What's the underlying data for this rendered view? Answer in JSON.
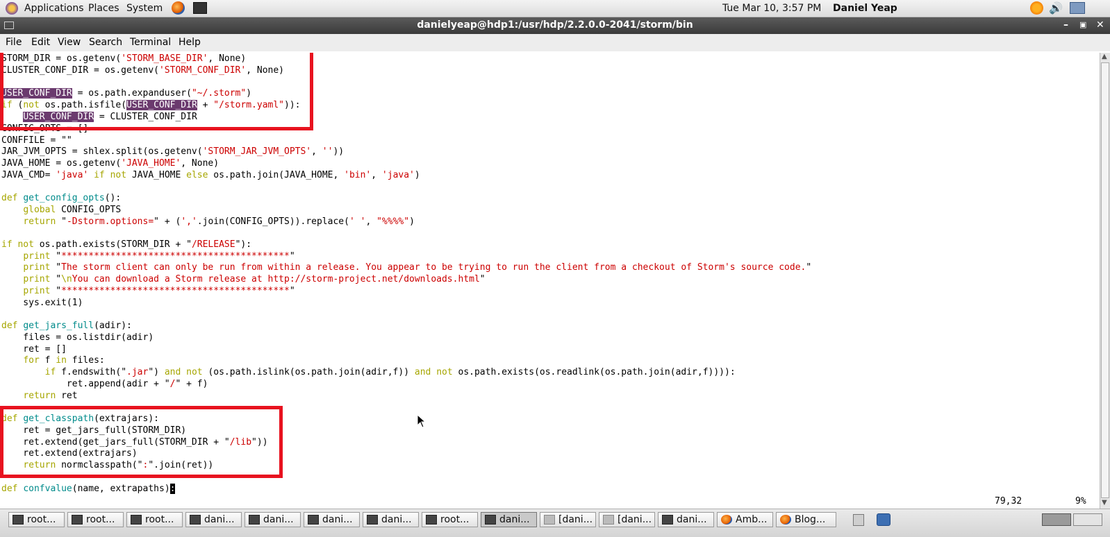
{
  "topbar": {
    "menus": [
      "Applications",
      "Places",
      "System"
    ],
    "clock": "Tue Mar 10,  3:57 PM",
    "user": "Daniel Yeap"
  },
  "window": {
    "title": "danielyeap@hdp1:/usr/hdp/2.2.0.0-2041/storm/bin",
    "menu": [
      "File",
      "Edit",
      "View",
      "Search",
      "Terminal",
      "Help"
    ]
  },
  "code": {
    "l1": [
      "STORM_DIR = os.getenv(",
      "'STORM_BASE_DIR'",
      ", None)"
    ],
    "l2": [
      "CLUSTER_CONF_DIR = os.getenv(",
      "'STORM_CONF_DIR'",
      ", None)"
    ],
    "l4": [
      "USER_CONF_DIR",
      " = os.path.expanduser(",
      "\"~/.storm\"",
      ")"
    ],
    "l5": [
      "if",
      " (",
      "not",
      " os.path.isfile(",
      "USER_CONF_DIR",
      " + ",
      "\"/storm.yaml\"",
      ")):"
    ],
    "l6": [
      "    ",
      "USER_CONF_DIR",
      " = CLUSTER_CONF_DIR"
    ],
    "l7": [
      "CONFIG_OPTS = []"
    ],
    "l8": [
      "CONFFILE = \"\""
    ],
    "l9": [
      "JAR_JVM_OPTS = shlex.split(os.getenv(",
      "'STORM_JAR_JVM_OPTS'",
      ", ",
      "''",
      "))"
    ],
    "l10": [
      "JAVA_HOME = os.getenv(",
      "'JAVA_HOME'",
      ", None)"
    ],
    "l11": [
      "JAVA_CMD= ",
      "'java'",
      " ",
      "if",
      " ",
      "not",
      " JAVA_HOME ",
      "else",
      " os.path.join(JAVA_HOME, ",
      "'bin'",
      ", ",
      "'java'",
      ")"
    ],
    "l13": [
      "def",
      " ",
      "get_config_opts",
      "():"
    ],
    "l14": [
      "    ",
      "global",
      " CONFIG_OPTS"
    ],
    "l15": [
      "    ",
      "return",
      " \"",
      "-Dstorm.options=",
      "\" + (",
      "','",
      ".join(CONFIG_OPTS)).replace(",
      "' '",
      ", ",
      "\"%%%%\"",
      ")"
    ],
    "l17": [
      "if",
      " ",
      "not",
      " os.path.exists(STORM_DIR + \"",
      "/RELEASE",
      "\"):"
    ],
    "l18": [
      "    ",
      "print",
      " \"",
      "******************************************",
      "\""
    ],
    "l19": [
      "    ",
      "print",
      " \"",
      "The storm client can only be run from within a release. You appear to be trying to run the client from a checkout of Storm's source code.",
      "\""
    ],
    "l20": [
      "    ",
      "print",
      " \"",
      "\\n",
      "You can download a Storm release at http://storm-project.net/downloads.html",
      "\""
    ],
    "l21": [
      "    ",
      "print",
      " \"",
      "******************************************",
      "\""
    ],
    "l22": [
      "    sys.exit(1)"
    ],
    "l24": [
      "def",
      " ",
      "get_jars_full",
      "(adir):"
    ],
    "l25": [
      "    files = os.listdir(adir)"
    ],
    "l26": [
      "    ret = []"
    ],
    "l27": [
      "    ",
      "for",
      " f ",
      "in",
      " files:"
    ],
    "l28": [
      "        ",
      "if",
      " f.endswith(\"",
      ".jar",
      "\") ",
      "and",
      " ",
      "not",
      " (os.path.islink(os.path.join(adir,f)) ",
      "and",
      " ",
      "not",
      " os.path.exists(os.readlink(os.path.join(adir,f)))):"
    ],
    "l29": [
      "            ret.append(adir + \"",
      "/",
      "\" + f)"
    ],
    "l30": [
      "    ",
      "return",
      " ret"
    ],
    "l32": [
      "def",
      " ",
      "get_classpath",
      "(extrajars):"
    ],
    "l33": [
      "    ret = get_jars_full(STORM_DIR)"
    ],
    "l34": [
      "    ret.extend(get_jars_full(STORM_DIR + \"",
      "/lib",
      "\"))"
    ],
    "l35": [
      "    ret.extend(extrajars)"
    ],
    "l36": [
      "    ",
      "return",
      " normclasspath(\"",
      ":",
      "\".join(ret))"
    ],
    "l38": [
      "def",
      " ",
      "confvalue",
      "(name, extrapaths)",
      ":"
    ]
  },
  "status": {
    "position": "79,32",
    "percent": "9%"
  },
  "taskbar": {
    "tasks": [
      "root...",
      "root...",
      "root...",
      "dani...",
      "dani...",
      "dani...",
      "dani...",
      "root...",
      "dani...",
      "[dani...",
      "[dani...",
      "dani...",
      "Amb...",
      "Blog..."
    ]
  },
  "colors": {
    "highlight_box": "#e8121f",
    "keyword": "#a6a600",
    "function": "#008b8b",
    "string": "#cc0000",
    "search_highlight": "#6b3a6e"
  }
}
